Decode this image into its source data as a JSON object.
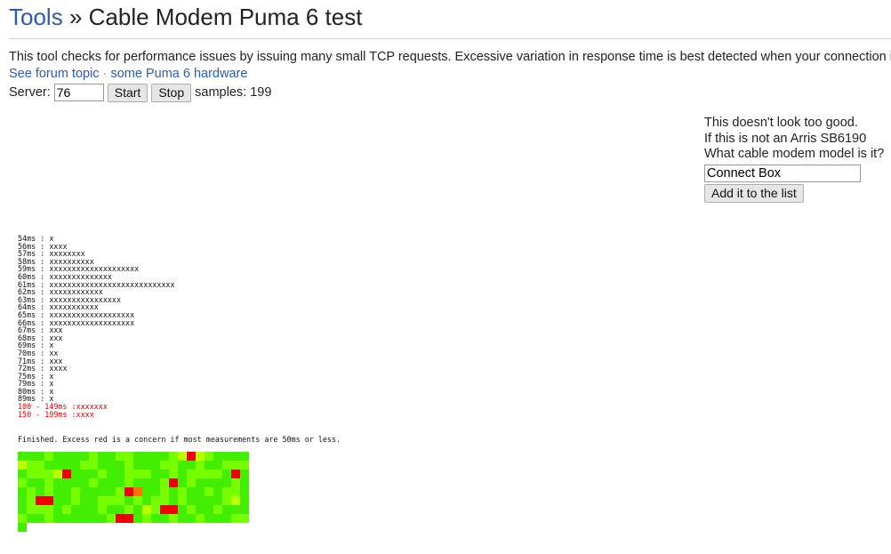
{
  "header": {
    "breadcrumb_link": "Tools",
    "separator": "»",
    "title": "Cable Modem Puma 6 test"
  },
  "intro": {
    "text": "This tool checks for performance issues by issuing many small TCP requests. Excessive variation in response time is best detected when your connection is completely idle."
  },
  "links": {
    "forum": "See forum topic",
    "sep": "·",
    "hardware": "some Puma 6 hardware"
  },
  "controls": {
    "server_label": "Server:",
    "server_value": "76",
    "start_label": "Start",
    "stop_label": "Stop",
    "samples_text": "samples: 199"
  },
  "side_panel": {
    "line1": "This doesn't look too good.",
    "line2": "If this is not an Arris SB6190",
    "line3": "What cable modem model is it?",
    "model_value": "Connect Box",
    "add_label": "Add it to the list"
  },
  "histogram": [
    {
      "label": "54ms",
      "bar": "x"
    },
    {
      "label": "56ms",
      "bar": "xxxx"
    },
    {
      "label": "57ms",
      "bar": "xxxxxxxx"
    },
    {
      "label": "58ms",
      "bar": "xxxxxxxxxx"
    },
    {
      "label": "59ms",
      "bar": "xxxxxxxxxxxxxxxxxxxx"
    },
    {
      "label": "60ms",
      "bar": "xxxxxxxxxxxxxx"
    },
    {
      "label": "61ms",
      "bar": "xxxxxxxxxxxxxxxxxxxxxxxxxxxx"
    },
    {
      "label": "62ms",
      "bar": "xxxxxxxxxxxx"
    },
    {
      "label": "63ms",
      "bar": "xxxxxxxxxxxxxxxx"
    },
    {
      "label": "64ms",
      "bar": "xxxxxxxxxxx"
    },
    {
      "label": "65ms",
      "bar": "xxxxxxxxxxxxxxxxxxx"
    },
    {
      "label": "66ms",
      "bar": "xxxxxxxxxxxxxxxxxxx"
    },
    {
      "label": "67ms",
      "bar": "xxx"
    },
    {
      "label": "68ms",
      "bar": "xxx"
    },
    {
      "label": "69ms",
      "bar": "x"
    },
    {
      "label": "70ms",
      "bar": "xx"
    },
    {
      "label": "71ms",
      "bar": "xxx"
    },
    {
      "label": "72ms",
      "bar": "xxxx"
    },
    {
      "label": "75ms",
      "bar": "x"
    },
    {
      "label": "79ms",
      "bar": "x"
    },
    {
      "label": "80ms",
      "bar": "x"
    },
    {
      "label": "89ms",
      "bar": "x"
    },
    {
      "label": "100 - 149ms",
      "bar": "xxxxxxx",
      "red": true
    },
    {
      "label": "150 - 199ms",
      "bar": "xxxx",
      "red": true
    }
  ],
  "finished_text": "Finished. Excess red is a concern if most measurements are 50ms or less.",
  "heatmap": {
    "columns": 26,
    "rows": [
      "ggglgggglggllgggglyrylgggg",
      "yllggggllggglgggllgglgglll",
      "glllyrggglgglllgglgllllgrg",
      "lgglgggglggglggglrglgggglg",
      "glglgglgggglrogglglgglgllg",
      "glrrgglgglllglgllglgggglyg",
      "glllglggglgglgylrrglgglggg",
      "lgglgggggglrrglgglgglgggll",
      "g"
    ],
    "colors": {
      "g": "#44ee00",
      "l": "#77ff00",
      "y": "#bbff00",
      "o": "#ff7700",
      "r": "#ee0000"
    }
  }
}
